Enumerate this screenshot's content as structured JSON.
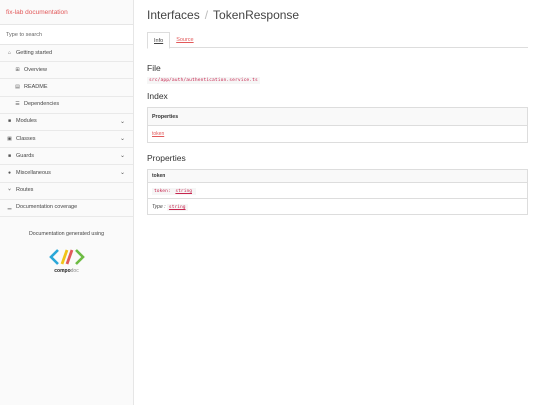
{
  "sidebar": {
    "brand": "fix-lab documentation",
    "search_placeholder": "Type to search",
    "items": [
      {
        "label": "Getting started",
        "icon": "home-icon",
        "sub": false,
        "chevron": false
      },
      {
        "label": "Overview",
        "icon": "grid-icon",
        "sub": true,
        "chevron": false
      },
      {
        "label": "README",
        "icon": "book-icon",
        "sub": true,
        "chevron": false
      },
      {
        "label": "Dependencies",
        "icon": "list-icon",
        "sub": true,
        "chevron": false
      },
      {
        "label": "Modules",
        "icon": "archive-icon",
        "sub": false,
        "chevron": true
      },
      {
        "label": "Classes",
        "icon": "file-icon",
        "sub": false,
        "chevron": true
      },
      {
        "label": "Guards",
        "icon": "lock-icon",
        "sub": false,
        "chevron": true
      },
      {
        "label": "Miscellaneous",
        "icon": "cube-icon",
        "sub": false,
        "chevron": true
      },
      {
        "label": "Routes",
        "icon": "route-icon",
        "sub": false,
        "chevron": false
      },
      {
        "label": "Documentation coverage",
        "icon": "bar-chart-icon",
        "sub": false,
        "chevron": false
      }
    ],
    "generated_text": "Documentation generated using",
    "logo_bold": "compo",
    "logo_light": "doc"
  },
  "breadcrumb": {
    "section": "Interfaces",
    "separator": "/",
    "name": "TokenResponse"
  },
  "tabs": {
    "info": "Info",
    "source": "Source"
  },
  "file": {
    "heading": "File",
    "path": "src/app/auth/authentication.service.ts"
  },
  "index": {
    "heading": "Index",
    "table_header": "Properties",
    "items": [
      "token"
    ]
  },
  "properties": {
    "heading": "Properties",
    "name": "token",
    "signature_name": "token:",
    "signature_type": "string",
    "type_label": "Type :",
    "type_value": "string"
  },
  "colors": {
    "accent": "#e2595a",
    "code": "#c7254e"
  }
}
